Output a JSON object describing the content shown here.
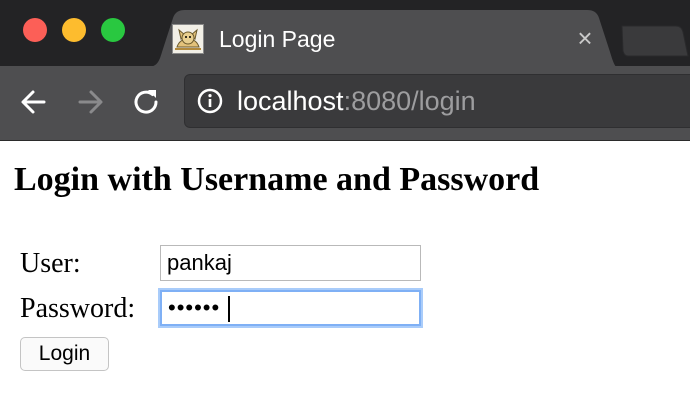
{
  "browser": {
    "tab": {
      "title": "Login Page",
      "close_glyph": "×",
      "favicon": "tomcat-cat-icon"
    },
    "url": {
      "host": "localhost",
      "rest": ":8080/login"
    },
    "icons": {
      "back": "back-arrow-icon",
      "forward": "forward-arrow-icon",
      "reload": "reload-icon",
      "info": "info-icon"
    },
    "colors": {
      "close": "#fc5f57",
      "minimize": "#fdbc2e",
      "maximize": "#29c840",
      "tabbar": "#232325",
      "toolbar": "#4e4e50",
      "focus_ring": "#7fb0f5"
    }
  },
  "page": {
    "heading": "Login with Username and Password",
    "form": {
      "user_label": "User:",
      "user_value": "pankaj",
      "password_label": "Password:",
      "password_value": "••••••",
      "password_focused": true,
      "submit_label": "Login"
    }
  }
}
